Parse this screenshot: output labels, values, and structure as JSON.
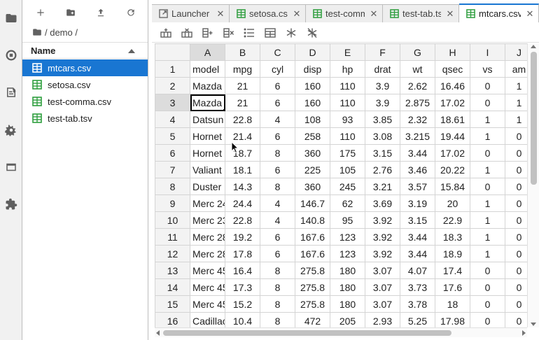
{
  "breadcrumb": {
    "path": "/ demo /"
  },
  "file_browser": {
    "column_header": "Name",
    "files": [
      {
        "name": "mtcars.csv",
        "selected": true
      },
      {
        "name": "setosa.csv",
        "selected": false
      },
      {
        "name": "test-comma.csv",
        "selected": false
      },
      {
        "name": "test-tab.tsv",
        "selected": false
      }
    ]
  },
  "tabs": [
    {
      "label": "Launcher",
      "icon": "launcher-icon",
      "active": false
    },
    {
      "label": "setosa.csv",
      "icon": "grid-icon",
      "active": false
    },
    {
      "label": "test-comma.csv",
      "icon": "grid-icon",
      "active": false
    },
    {
      "label": "test-tab.tsv",
      "icon": "grid-icon",
      "active": false
    },
    {
      "label": "mtcars.csv",
      "icon": "grid-icon",
      "active": true
    }
  ],
  "grid": {
    "column_letters": [
      "A",
      "B",
      "C",
      "D",
      "E",
      "F",
      "G",
      "H",
      "I",
      "J"
    ],
    "active_row": 3,
    "active_col": "A",
    "rows": [
      [
        "1",
        "model",
        "mpg",
        "cyl",
        "disp",
        "hp",
        "drat",
        "wt",
        "qsec",
        "vs",
        "am"
      ],
      [
        "2",
        "Mazda",
        "21",
        "6",
        "160",
        "110",
        "3.9",
        "2.62",
        "16.46",
        "0",
        "1"
      ],
      [
        "3",
        "Mazda",
        "21",
        "6",
        "160",
        "110",
        "3.9",
        "2.875",
        "17.02",
        "0",
        "1"
      ],
      [
        "4",
        "Datsun",
        "22.8",
        "4",
        "108",
        "93",
        "3.85",
        "2.32",
        "18.61",
        "1",
        "1"
      ],
      [
        "5",
        "Hornet",
        "21.4",
        "6",
        "258",
        "110",
        "3.08",
        "3.215",
        "19.44",
        "1",
        "0"
      ],
      [
        "6",
        "Hornet",
        "18.7",
        "8",
        "360",
        "175",
        "3.15",
        "3.44",
        "17.02",
        "0",
        "0"
      ],
      [
        "7",
        "Valiant",
        "18.1",
        "6",
        "225",
        "105",
        "2.76",
        "3.46",
        "20.22",
        "1",
        "0"
      ],
      [
        "8",
        "Duster",
        "14.3",
        "8",
        "360",
        "245",
        "3.21",
        "3.57",
        "15.84",
        "0",
        "0"
      ],
      [
        "9",
        "Merc 24",
        "24.4",
        "4",
        "146.7",
        "62",
        "3.69",
        "3.19",
        "20",
        "1",
        "0"
      ],
      [
        "10",
        "Merc 23",
        "22.8",
        "4",
        "140.8",
        "95",
        "3.92",
        "3.15",
        "22.9",
        "1",
        "0"
      ],
      [
        "11",
        "Merc 28",
        "19.2",
        "6",
        "167.6",
        "123",
        "3.92",
        "3.44",
        "18.3",
        "1",
        "0"
      ],
      [
        "12",
        "Merc 28",
        "17.8",
        "6",
        "167.6",
        "123",
        "3.92",
        "3.44",
        "18.9",
        "1",
        "0"
      ],
      [
        "13",
        "Merc 45",
        "16.4",
        "8",
        "275.8",
        "180",
        "3.07",
        "4.07",
        "17.4",
        "0",
        "0"
      ],
      [
        "14",
        "Merc 45",
        "17.3",
        "8",
        "275.8",
        "180",
        "3.07",
        "3.73",
        "17.6",
        "0",
        "0"
      ],
      [
        "15",
        "Merc 45",
        "15.2",
        "8",
        "275.8",
        "180",
        "3.07",
        "3.78",
        "18",
        "0",
        "0"
      ],
      [
        "16",
        "Cadillac",
        "10.4",
        "8",
        "472",
        "205",
        "2.93",
        "5.25",
        "17.98",
        "0",
        "0"
      ]
    ]
  },
  "colors": {
    "accent": "#1976d2",
    "grid_icon": "#2e9e3e",
    "selected_text": "#ffffff"
  }
}
